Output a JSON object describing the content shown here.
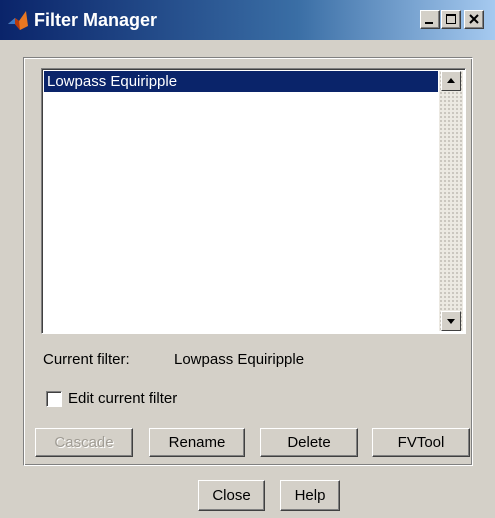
{
  "window": {
    "title": "Filter Manager",
    "app_icon": "matlab-icon",
    "controls": [
      "minimize-icon",
      "maximize-icon",
      "close-icon"
    ]
  },
  "filter_list": {
    "items": [
      {
        "label": "Lowpass Equiripple",
        "selected": true
      }
    ]
  },
  "current_filter": {
    "label": "Current filter:",
    "value": "Lowpass Equiripple"
  },
  "edit_checkbox": {
    "label": "Edit current filter",
    "checked": false
  },
  "actions": {
    "cascade": {
      "label": "Cascade",
      "enabled": false
    },
    "rename": {
      "label": "Rename",
      "enabled": true
    },
    "delete": {
      "label": "Delete",
      "enabled": true
    },
    "fvtool": {
      "label": "FVTool",
      "enabled": true
    }
  },
  "footer": {
    "close": "Close",
    "help": "Help"
  },
  "colors": {
    "titlebar_start": "#0a246a",
    "titlebar_end": "#a6caf0",
    "selection": "#0a246a",
    "face": "#d4d0c8"
  }
}
